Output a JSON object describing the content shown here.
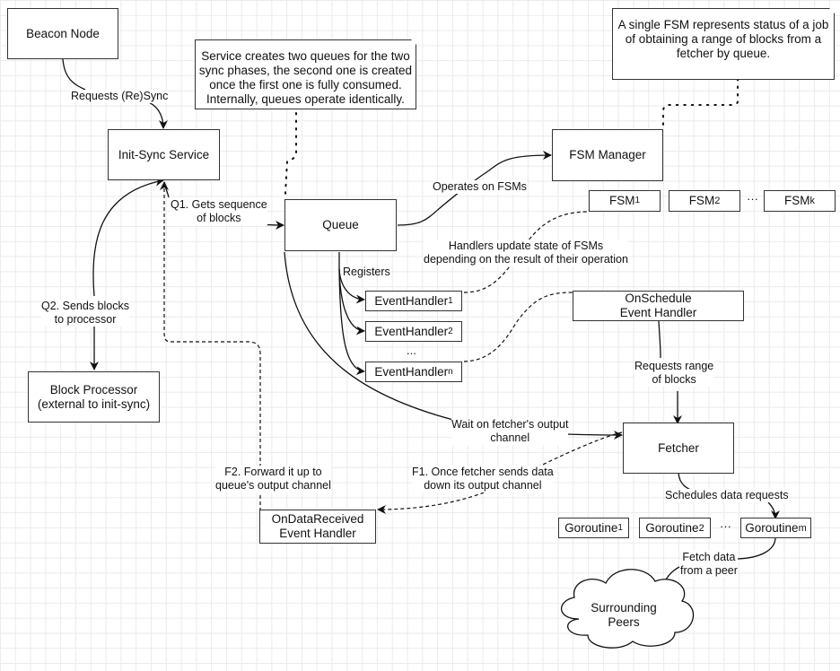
{
  "nodes": {
    "beacon_node": "Beacon Node",
    "init_sync_service": "Init-Sync Service",
    "block_processor_line1": "Block Processor",
    "block_processor_line2": "(external to init-sync)",
    "queue": "Queue",
    "fsm_manager": "FSM Manager",
    "fsm_1": "FSM",
    "fsm_1_sub": "1",
    "fsm_2": "FSM",
    "fsm_2_sub": "2",
    "fsm_k": "FSM",
    "fsm_k_sub": "k",
    "fsm_ellipsis": "···",
    "event_handler_1": "EventHandler",
    "event_handler_1_sub": "1",
    "event_handler_2": "EventHandler",
    "event_handler_2_sub": "2",
    "event_handler_ellipsis": "...",
    "event_handler_n": "EventHandler",
    "event_handler_n_sub": "n",
    "on_schedule_line1": "OnSchedule",
    "on_schedule_line2": "Event Handler",
    "fetcher": "Fetcher",
    "on_data_received_line1": "OnDataReceived",
    "on_data_received_line2": "Event Handler",
    "goroutine_1": "Goroutine",
    "goroutine_1_sub": "1",
    "goroutine_2": "Goroutine",
    "goroutine_2_sub": "2",
    "goroutine_m": "Goroutine",
    "goroutine_m_sub": "m",
    "goroutine_ellipsis": "···",
    "surrounding_peers_line1": "Surrounding",
    "surrounding_peers_line2": "Peers"
  },
  "notes": {
    "queues_note": [
      "Service creates two queues for the two",
      "sync phases, the second one is created",
      "once the first one is fully consumed.",
      "Internally, queues operate identically."
    ],
    "fsm_note": [
      "A single FSM represents status of a job",
      "of obtaining a range of blocks from a",
      "fetcher by queue."
    ]
  },
  "edge_labels": {
    "requests_resync": "Requests (Re)Sync",
    "q1_line1": "Q1. Gets sequence",
    "q1_line2": "of blocks",
    "q2_line1": "Q2. Sends blocks",
    "q2_line2": "to processor",
    "operates_on_fsms": "Operates on FSMs",
    "handlers_update_line1": "Handlers update state of FSMs",
    "handlers_update_line2": "depending on the result of their operation",
    "registers": "Registers",
    "requests_range_line1": "Requests range",
    "requests_range_line2": "of blocks",
    "wait_on_fetcher_line1": "Wait on fetcher's output",
    "wait_on_fetcher_line2": "channel",
    "f1_line1": "F1. Once fetcher sends data",
    "f1_line2": "down its output channel",
    "f2_line1": "F2. Forward it up to",
    "f2_line2": "queue's output channel",
    "schedules_data_requests": "Schedules data requests",
    "fetch_data_line1": "Fetch data",
    "fetch_data_line2": "from a peer"
  }
}
